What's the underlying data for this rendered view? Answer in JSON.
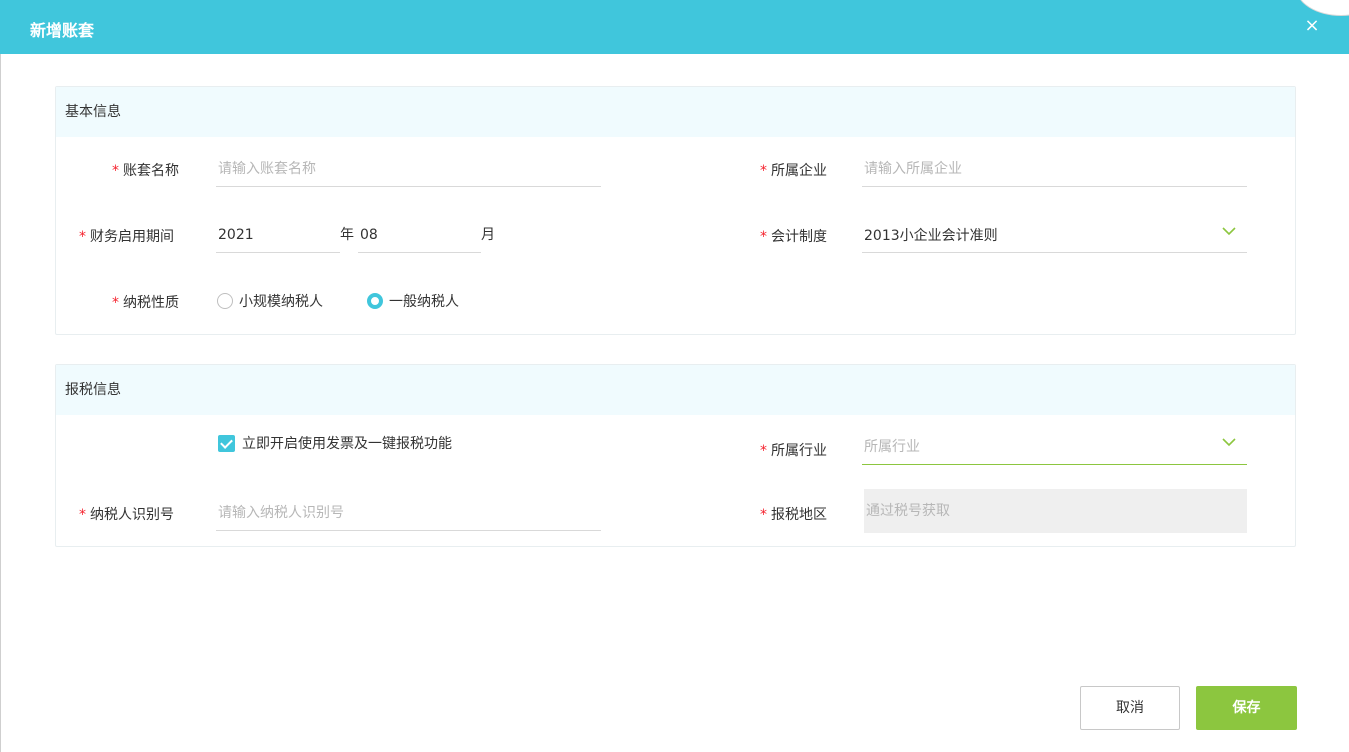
{
  "dialog": {
    "title": "新增账套",
    "close_glyph": "×"
  },
  "basic_info": {
    "section_title": "基本信息",
    "required_mark": "*",
    "account_name": {
      "label": "账套名称",
      "placeholder": "请输入账套名称",
      "value": ""
    },
    "company": {
      "label": "所属企业",
      "placeholder": "请输入所属企业",
      "value": ""
    },
    "period": {
      "label": "财务启用期间",
      "year": "2021",
      "year_unit": "年",
      "month": "08",
      "month_unit": "月"
    },
    "accounting_system": {
      "label": "会计制度",
      "value": "2013小企业会计准则",
      "icon": "chevron-down-icon"
    },
    "tax_type": {
      "label": "纳税性质",
      "options": [
        "小规模纳税人",
        "一般纳税人"
      ],
      "selected": "一般纳税人"
    }
  },
  "tax_info": {
    "section_title": "报税信息",
    "required_mark": "*",
    "enable_invoice": {
      "label": "立即开启使用发票及一键报税功能",
      "checked": true
    },
    "industry": {
      "label": "所属行业",
      "placeholder": "所属行业",
      "value": "",
      "icon": "chevron-down-icon"
    },
    "taxpayer_id": {
      "label": "纳税人识别号",
      "placeholder": "请输入纳税人识别号",
      "value": ""
    },
    "tax_region": {
      "label": "报税地区",
      "placeholder": "通过税号获取",
      "value": ""
    }
  },
  "footer": {
    "cancel_label": "取消",
    "save_label": "保存"
  },
  "colors": {
    "header": "#40c6dc",
    "accent_green": "#8cc63f",
    "required": "#f5222d",
    "section_header_bg": "#f0fbfe"
  }
}
